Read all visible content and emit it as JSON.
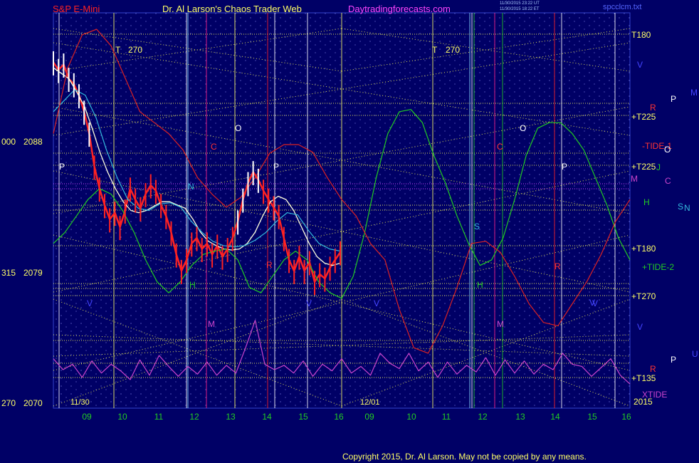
{
  "header": {
    "instrument": "S&P E-Mini",
    "site": "Dr. Al Larson's Chaos Trader Web",
    "url": "Daytradingforecasts.com",
    "timestamp1": "11/30/2015 23:22 UT",
    "timestamp2": "11/30/2015 18:22 ET",
    "file": "spcclcm.txt"
  },
  "footer": {
    "copyright": "Copyright 2015, Dr. Al Larson. May not be copied by any means."
  },
  "colors": {
    "background": "#000066",
    "grid": "#ffff66",
    "price": "#ff2222",
    "tide": "#22cc22",
    "xtide": "#cc44cc",
    "channel": "#dd2222",
    "avg": "#33bbdd"
  },
  "chart_data": {
    "type": "line",
    "ylim": [
      2067,
      2103
    ],
    "y_ticks": [
      {
        "left": "000",
        "price": "2088"
      },
      {
        "left": "315",
        "price": "2079"
      },
      {
        "left": "270",
        "price": "2070"
      }
    ],
    "x_ticks_day1": [
      "09",
      "10",
      "11",
      "12",
      "13",
      "14",
      "15",
      "16"
    ],
    "x_ticks_day2": [
      "09",
      "10",
      "11",
      "12",
      "13",
      "14",
      "15",
      "16"
    ],
    "date_labels": [
      "11/30",
      "12/01"
    ],
    "year_label": "2015",
    "right_labels": [
      {
        "text": "T180",
        "color": "#ffff66"
      },
      {
        "text": "+T225",
        "color": "#ffff66"
      },
      {
        "text": "-TIDE-1",
        "color": "#ff3333"
      },
      {
        "text": "+T225",
        "color": "#ffff66"
      },
      {
        "text": "+T180",
        "color": "#ffff66"
      },
      {
        "text": "+TIDE-2",
        "color": "#22cc22"
      },
      {
        "text": "+T270",
        "color": "#ffff66"
      },
      {
        "text": "+T135",
        "color": "#ffff66"
      },
      {
        "text": "XTIDE",
        "color": "#cc44cc"
      },
      {
        "text": "H",
        "color": "#22cc22"
      },
      {
        "text": "J",
        "color": "#22cc22"
      },
      {
        "text": "M",
        "color": "#cc44cc"
      },
      {
        "text": "C",
        "color": "#cc44cc"
      },
      {
        "text": "P",
        "color": "#ffffff"
      },
      {
        "text": "P",
        "color": "#ffffff"
      },
      {
        "text": "O",
        "color": "#ffffff"
      },
      {
        "text": "S",
        "color": "#33bbdd"
      },
      {
        "text": "N",
        "color": "#33bbdd"
      },
      {
        "text": "R",
        "color": "#ff3333"
      },
      {
        "text": "R",
        "color": "#ff3333"
      },
      {
        "text": "V",
        "color": "#4444ff"
      },
      {
        "text": "V",
        "color": "#4444ff"
      },
      {
        "text": "V",
        "color": "#4444ff"
      },
      {
        "text": "U",
        "color": "#4444ff"
      },
      {
        "text": "M",
        "color": "#4444ff"
      }
    ],
    "in_chart_labels": [
      {
        "text": "T",
        "color": "#ffff66"
      },
      {
        "text": "270",
        "color": "#ffff66"
      },
      {
        "text": "T",
        "color": "#ffff66"
      },
      {
        "text": "270",
        "color": "#ffff66"
      },
      {
        "text": "O",
        "color": "#ffffff"
      },
      {
        "text": "O",
        "color": "#ffffff"
      },
      {
        "text": "P",
        "color": "#ffffff"
      },
      {
        "text": "P",
        "color": "#ffffff"
      },
      {
        "text": "P",
        "color": "#ffffff"
      },
      {
        "text": "N",
        "color": "#33bbdd"
      },
      {
        "text": "S",
        "color": "#33bbdd"
      },
      {
        "text": "H",
        "color": "#22cc22"
      },
      {
        "text": "H",
        "color": "#22cc22"
      },
      {
        "text": "M",
        "color": "#cc44cc"
      },
      {
        "text": "M",
        "color": "#cc44cc"
      },
      {
        "text": "R",
        "color": "#ff3333"
      },
      {
        "text": "R",
        "color": "#ff3333"
      },
      {
        "text": "C",
        "color": "#ff3333"
      },
      {
        "text": "C",
        "color": "#ff3333"
      },
      {
        "text": "V",
        "color": "#4444ff"
      },
      {
        "text": "V",
        "color": "#4444ff"
      },
      {
        "text": "V",
        "color": "#4444ff"
      },
      {
        "text": "V",
        "color": "#4444ff"
      }
    ],
    "series": [
      {
        "color": "#ff2222",
        "values": [
          2098.5,
          2097.8,
          2098.3,
          2097,
          2096.5,
          2095.5,
          2094,
          2092,
          2089,
          2087,
          2085.5,
          2084.2,
          2084.8,
          2083.5,
          2085,
          2087,
          2086,
          2085.2,
          2086.5,
          2087.3,
          2086.8,
          2085.5,
          2084.5,
          2083,
          2081,
          2079.5,
          2080.5,
          2082,
          2082.5,
          2081.5,
          2082,
          2081,
          2081.8,
          2080.8,
          2081.5,
          2082.5,
          2084,
          2086,
          2087.5,
          2088.5,
          2087.8,
          2086.8,
          2086,
          2085.3,
          2084.5,
          2082.5,
          2080.5,
          2079.5,
          2080.8,
          2079.5,
          2080.3,
          2078.5,
          2079.2,
          2078.8,
          2079.8,
          2080.5,
          2081.2
        ]
      },
      {
        "color": "#ffffdd",
        "values": [
          2098,
          2097.5,
          2097,
          2095.8,
          2094.5,
          2092.5,
          2090.3,
          2088.5,
          2087,
          2085.8,
          2085,
          2084.8,
          2085,
          2085.4,
          2085.8,
          2085.8,
          2085.5,
          2085.2,
          2084.2,
          2083,
          2082.2,
          2081.8,
          2081.5,
          2081.4,
          2081.5,
          2082,
          2083,
          2084.5,
          2085.8,
          2086.3,
          2086,
          2085,
          2083.5,
          2082,
          2080.8,
          2080.2,
          2080,
          2080.2
        ]
      },
      {
        "color": "#33bbdd",
        "values": [
          2094,
          2095,
          2096,
          2095.5,
          2093.5,
          2090.5,
          2088,
          2086,
          2085.2,
          2085,
          2085.6,
          2085.7,
          2085.3,
          2084,
          2083,
          2082.2,
          2081.8,
          2081.7,
          2081.8,
          2082.3,
          2083,
          2084,
          2084.8,
          2084.6,
          2083.2,
          2082,
          2081.5,
          2081.3
        ]
      },
      {
        "color": "#22cc22",
        "values": [
          2082,
          2083,
          2084.5,
          2086,
          2087,
          2086.5,
          2085,
          2083,
          2080.5,
          2078.5,
          2077.5,
          2078.5,
          2080,
          2081,
          2081.3,
          2081.5,
          2080.5,
          2078,
          2077.5,
          2079,
          2080.5,
          2081.3,
          2080.5,
          2078.5,
          2077.5,
          2077,
          2079,
          2083,
          2088,
          2092,
          2094,
          2094.2,
          2093,
          2090,
          2087.5,
          2084.5,
          2082,
          2080,
          2080.5,
          2082.5,
          2086,
          2090,
          2092.5,
          2093,
          2093,
          2092,
          2090.5,
          2088,
          2085.5,
          2082.5,
          2080.5
        ]
      },
      {
        "color": "#dd2222",
        "values": [
          2092,
          2098,
          2101,
          2101.5,
          2100,
          2097,
          2094,
          2093,
          2092,
          2090.5,
          2088,
          2086.5,
          2085.3,
          2086.2,
          2088,
          2090.2,
          2091,
          2091,
          2090.3,
          2088,
          2086,
          2084.5,
          2082,
          2080.5,
          2076,
          2072.5,
          2072,
          2074.5,
          2078,
          2082,
          2082.2,
          2081.2,
          2079,
          2076.5,
          2074.8,
          2074.5,
          2076.5,
          2078.5,
          2081,
          2084,
          2086
        ]
      },
      {
        "color": "#cc44cc",
        "values": [
          2071.5,
          2070.5,
          2071,
          2069.8,
          2071.3,
          2070.2,
          2071,
          2070.4,
          2069.6,
          2071.4,
          2070,
          2071.8,
          2070.8,
          2069.9,
          2070.8,
          2070.1,
          2071.2,
          2070,
          2070.9,
          2070.2,
          2072.5,
          2075,
          2071,
          2070.5,
          2070.9,
          2070.2,
          2071.3,
          2069.9,
          2071,
          2070.4,
          2071.5,
          2070.2,
          2070.8,
          2070,
          2072,
          2071.1,
          2070.6,
          2072,
          2070.4,
          2071.2,
          2069.8,
          2071.2,
          2070.1,
          2070.9,
          2070.3,
          2071.6,
          2070,
          2071.4,
          2070.2,
          2071.3,
          2070.1,
          2071,
          2070.5,
          2072,
          2071,
          2070.8,
          2069.9,
          2070.7,
          2071.5,
          2070,
          2069.2
        ]
      }
    ]
  }
}
